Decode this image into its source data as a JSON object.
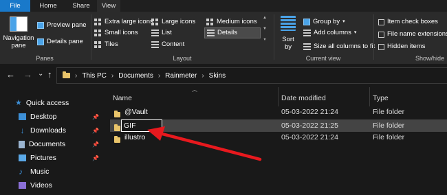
{
  "tabs": [
    {
      "label": "File"
    },
    {
      "label": "Home"
    },
    {
      "label": "Share"
    },
    {
      "label": "View"
    }
  ],
  "ribbon": {
    "panes": {
      "group_label": "Panes",
      "navigation_pane": "Navigation\npane",
      "preview_pane": "Preview pane",
      "details_pane": "Details pane"
    },
    "layout": {
      "group_label": "Layout",
      "extra_large_icons": "Extra large icons",
      "large_icons": "Large icons",
      "medium_icons": "Medium icons",
      "small_icons": "Small icons",
      "list": "List",
      "details": "Details",
      "tiles": "Tiles",
      "content": "Content"
    },
    "current_view": {
      "group_label": "Current view",
      "sort_by": "Sort\nby",
      "group_by": "Group by",
      "add_columns": "Add columns",
      "size_all_columns": "Size all columns to fit"
    },
    "show_hide": {
      "group_label": "Show/hide",
      "item_check_boxes": "Item check boxes",
      "file_name_extensions": "File name extensions",
      "hidden_items": "Hidden items"
    }
  },
  "nav": {
    "back": "←",
    "forward": "→",
    "recent": "⌄",
    "up": "↑"
  },
  "breadcrumb": [
    "This PC",
    "Documents",
    "Rainmeter",
    "Skins"
  ],
  "sidebar": {
    "quick_access": "Quick access",
    "items": [
      {
        "label": "Desktop",
        "icon": "desktop-icon",
        "pinned": true,
        "color": "#3d8fd6"
      },
      {
        "label": "Downloads",
        "icon": "downloads-icon",
        "pinned": true,
        "color": "#3d8fd6"
      },
      {
        "label": "Documents",
        "icon": "documents-icon",
        "pinned": true,
        "color": "#9ab4d0"
      },
      {
        "label": "Pictures",
        "icon": "pictures-icon",
        "pinned": true,
        "color": "#5aa8e6"
      },
      {
        "label": "Music",
        "icon": "music-icon",
        "pinned": false,
        "color": "#3d8fd6"
      },
      {
        "label": "Videos",
        "icon": "videos-icon",
        "pinned": false,
        "color": "#8a6fd6"
      }
    ]
  },
  "columns": {
    "name": "Name",
    "date_modified": "Date modified",
    "type": "Type"
  },
  "files": [
    {
      "name": "@Vault",
      "date": "05-03-2022 21:24",
      "type": "File folder",
      "selected": false
    },
    {
      "name": "GIF",
      "date": "05-03-2022 21:25",
      "type": "File folder",
      "selected": true,
      "renaming": true
    },
    {
      "name": "illustro",
      "date": "05-03-2022 21:24",
      "type": "File folder",
      "selected": false
    }
  ],
  "colors": {
    "accent": "#1979ca",
    "folder": "#e9c46a",
    "annotation_arrow": "#e8191e"
  }
}
